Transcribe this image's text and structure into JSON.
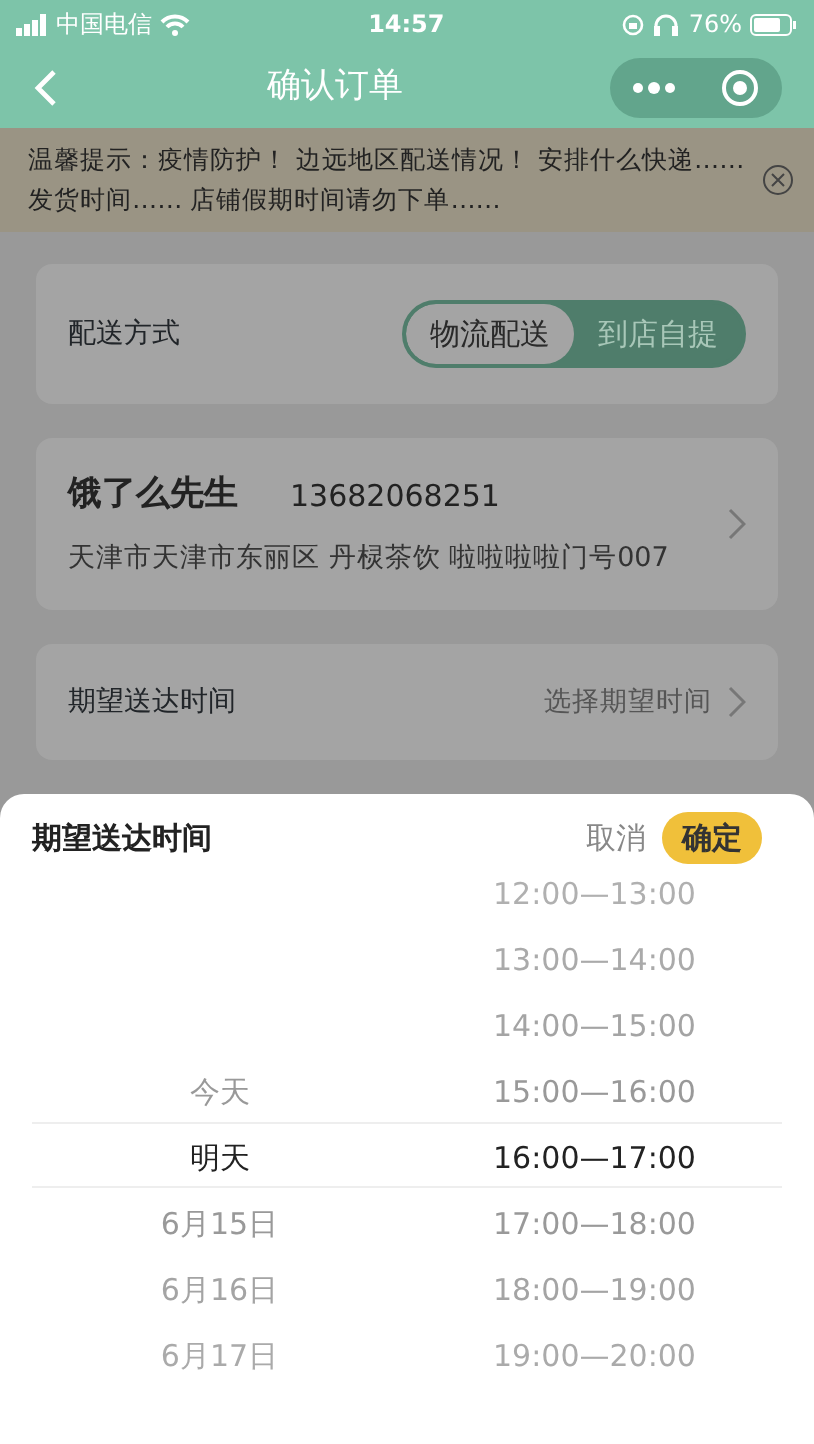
{
  "status_bar": {
    "carrier": "中国电信",
    "time": "14:57",
    "battery": "76%"
  },
  "nav": {
    "title": "确认订单"
  },
  "notice": {
    "text": "温馨提示：疫情防护！ 边远地区配送情况！ 安排什么快递……发货时间…… 店铺假期时间请勿下单……"
  },
  "delivery": {
    "label": "配送方式",
    "options": [
      {
        "label": "物流配送",
        "selected": true
      },
      {
        "label": "到店自提",
        "selected": false
      }
    ]
  },
  "address": {
    "name": "饿了么先生",
    "phone": "13682068251",
    "detail": "天津市天津市东丽区 丹棂茶饮 啦啦啦啦门号007"
  },
  "expected_time": {
    "label": "期望送达时间",
    "value": "选择期望时间"
  },
  "picker": {
    "title": "期望送达时间",
    "cancel": "取消",
    "confirm": "确定",
    "days": [
      {
        "label": "今天",
        "selected": false
      },
      {
        "label": "明天",
        "selected": true
      },
      {
        "label": "6月15日",
        "selected": false
      },
      {
        "label": "6月16日",
        "selected": false
      },
      {
        "label": "6月17日",
        "selected": false
      }
    ],
    "times": [
      {
        "label": "12:00—13:00",
        "selected": false
      },
      {
        "label": "13:00—14:00",
        "selected": false
      },
      {
        "label": "14:00—15:00",
        "selected": false
      },
      {
        "label": "15:00—16:00",
        "selected": false
      },
      {
        "label": "16:00—17:00",
        "selected": true
      },
      {
        "label": "17:00—18:00",
        "selected": false
      },
      {
        "label": "18:00—19:00",
        "selected": false
      },
      {
        "label": "19:00—20:00",
        "selected": false
      }
    ]
  }
}
